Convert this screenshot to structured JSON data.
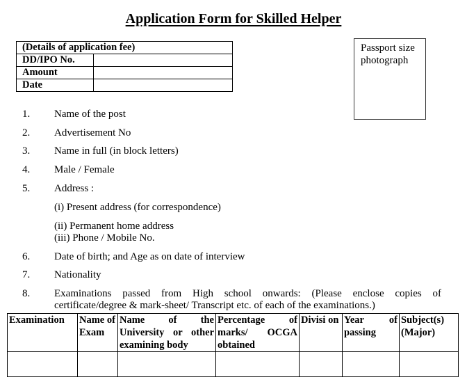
{
  "title": "Application Form for Skilled Helper",
  "fee_table": {
    "header": "(Details of application fee)",
    "rows": [
      {
        "label": "DD/IPO No.",
        "value": ""
      },
      {
        "label": "Amount",
        "value": ""
      },
      {
        "label": "Date",
        "value": ""
      }
    ]
  },
  "photo_box": {
    "label_line1": "Passport size",
    "label_line2": "photograph"
  },
  "items": [
    {
      "num": "1.",
      "label": "Name of the post"
    },
    {
      "num": "2.",
      "label": "Advertisement No"
    },
    {
      "num": "3.",
      "label": "Name in full (in block letters)"
    },
    {
      "num": "4.",
      "label": "Male / Female"
    },
    {
      "num": "5.",
      "label": "Address :"
    },
    {
      "num": "6.",
      "label": "Date of birth; and Age as on date of interview"
    },
    {
      "num": "7.",
      "label": "Nationality"
    },
    {
      "num": "8.",
      "label_line1": "Examinations passed from High school onwards: (Please enclose copies of",
      "label_line2": "certificate/degree & mark-sheet/ Transcript etc. of each of the examinations.)"
    }
  ],
  "address_sub": [
    "(i)  Present address (for correspondence)",
    "(ii)  Permanent home address",
    "(iii) Phone / Mobile No."
  ],
  "exam_table": {
    "headers": [
      "Examination",
      "Name of Exam",
      "Name of the University or other examining body",
      "Percentage of marks/ OCGA obtained",
      "Divisi on",
      "Year of passing",
      "Subject(s) (Major)"
    ],
    "rows": [
      [
        "",
        "",
        "",
        "",
        "",
        "",
        ""
      ]
    ]
  }
}
